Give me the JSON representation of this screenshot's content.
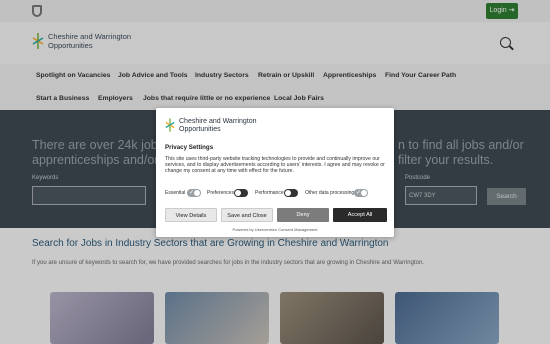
{
  "topbar": {
    "login_label": "Login ⇥"
  },
  "header": {
    "logo_text": "Cheshire and Warrington Opportunities"
  },
  "nav": {
    "row1": [
      "Spotlight on Vacancies",
      "Job Advice and Tools",
      "Industry Sectors",
      "Retrain or Upskill",
      "Apprenticeships",
      "Find Your Career Path"
    ],
    "row2": [
      "Start a Business",
      "Employers",
      "Jobs that require little or no experience",
      "Local Job Fairs"
    ]
  },
  "hero": {
    "text_left_1": "There are over 24k job va",
    "text_right_1": "n to find all jobs and/or",
    "text_left_2": "apprenticeships and/or fu",
    "text_right_2": "filter your results.",
    "keywords_label": "Keywords",
    "postcode_label": "Postcode",
    "postcode_placeholder": "CW7 3DY",
    "search_label": "Search"
  },
  "section": {
    "title": "Search for Jobs in Industry Sectors that are Growing in Cheshire and Warrington",
    "subtitle": "If you are unsure of keywords to search for, we have provided searches for jobs in the industry sectors that are growing in Cheshire and Warrington."
  },
  "modal": {
    "logo_text": "Cheshire and Warrington Opportunities",
    "title": "Privacy Settings",
    "description": "This site uses third-party website tracking technologies to provide and continually improve our services, and to display advertisements according to users' interests. I agree and may revoke or change my consent at any time with effect for the future.",
    "toggles": [
      {
        "label": "Essential",
        "state": "on"
      },
      {
        "label": "Preferences",
        "state": "off"
      },
      {
        "label": "Performance",
        "state": "off"
      },
      {
        "label": "Other data processing",
        "state": "on"
      }
    ],
    "buttons": {
      "view_details": "View Details",
      "save_close": "Save and Close",
      "deny": "Deny",
      "accept_all": "Accept All"
    },
    "powered_by": "Powered by Usercentrics Consent Management"
  },
  "colors": {
    "brand_green": "#2f7d32",
    "hero_bg": "#3f4a52",
    "title_blue": "#2c5a7a"
  },
  "icons": [
    "shield-icon",
    "logo-mark-icon",
    "search-icon"
  ]
}
